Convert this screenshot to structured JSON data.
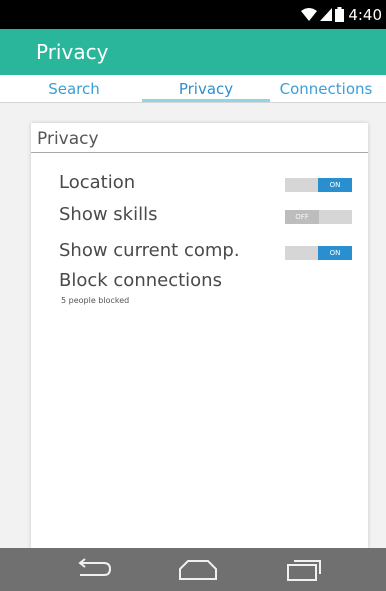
{
  "status_bar": {
    "time": "4:40",
    "icons": [
      "wifi-icon",
      "signal-icon",
      "battery-icon"
    ]
  },
  "app_bar": {
    "title": "Privacy",
    "color": "#2ab69b"
  },
  "tabs": [
    {
      "label": "Search",
      "selected": false
    },
    {
      "label": "Privacy",
      "selected": true
    },
    {
      "label": "Connections",
      "selected": false
    }
  ],
  "card": {
    "title": "Privacy",
    "settings": [
      {
        "label": "Location",
        "toggle": "ON",
        "state": "on"
      },
      {
        "label": "Show skills",
        "toggle": "OFF",
        "state": "off"
      },
      {
        "label": "Show current comp.",
        "toggle": "ON",
        "state": "on"
      }
    ],
    "block": {
      "title": "Block connections",
      "subtitle": "5 people blocked"
    }
  },
  "nav_bar": {
    "buttons": [
      "back-icon",
      "home-icon",
      "recents-icon"
    ]
  },
  "colors": {
    "accent_teal": "#2ab69b",
    "toggle_on": "#2a8fcf",
    "tab_text": "#3b9fd6",
    "nav_bar": "#707070"
  }
}
